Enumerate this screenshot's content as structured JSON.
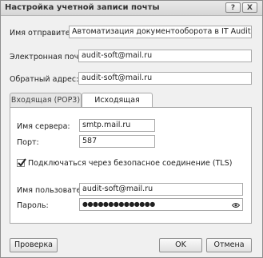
{
  "window": {
    "title": "Настройка учетной записи почты"
  },
  "titlebar_buttons": {
    "help": "?",
    "close": "X"
  },
  "sender": {
    "label": "Имя отправителя:",
    "value": "Автоматизация документооборота в IT Audit"
  },
  "email": {
    "label": "Электронная почта:",
    "value": "audit-soft@mail.ru"
  },
  "reply_to": {
    "label": "Обратный адрес:",
    "value": "audit-soft@mail.ru"
  },
  "tabs": [
    {
      "label": "Входящая (POP3)",
      "active": false
    },
    {
      "label": "Исходящая (SMTP)",
      "active": true
    }
  ],
  "smtp": {
    "server_label": "Имя сервера:",
    "server_value": "smtp.mail.ru",
    "port_label": "Порт:",
    "port_value": "587",
    "tls_label": "Подключаться через безопасное соединение (TLS)",
    "tls_checked": true,
    "user_label": "Имя пользователя:",
    "user_value": "audit-soft@mail.ru",
    "password_label": "Пароль:",
    "password_value": "●●●●●●●●●●●●●●"
  },
  "buttons": {
    "check": "Проверка",
    "ok": "OK",
    "cancel": "Отмена"
  },
  "icons": {
    "eye": "eye-icon",
    "checkmark": "checkmark-icon"
  }
}
